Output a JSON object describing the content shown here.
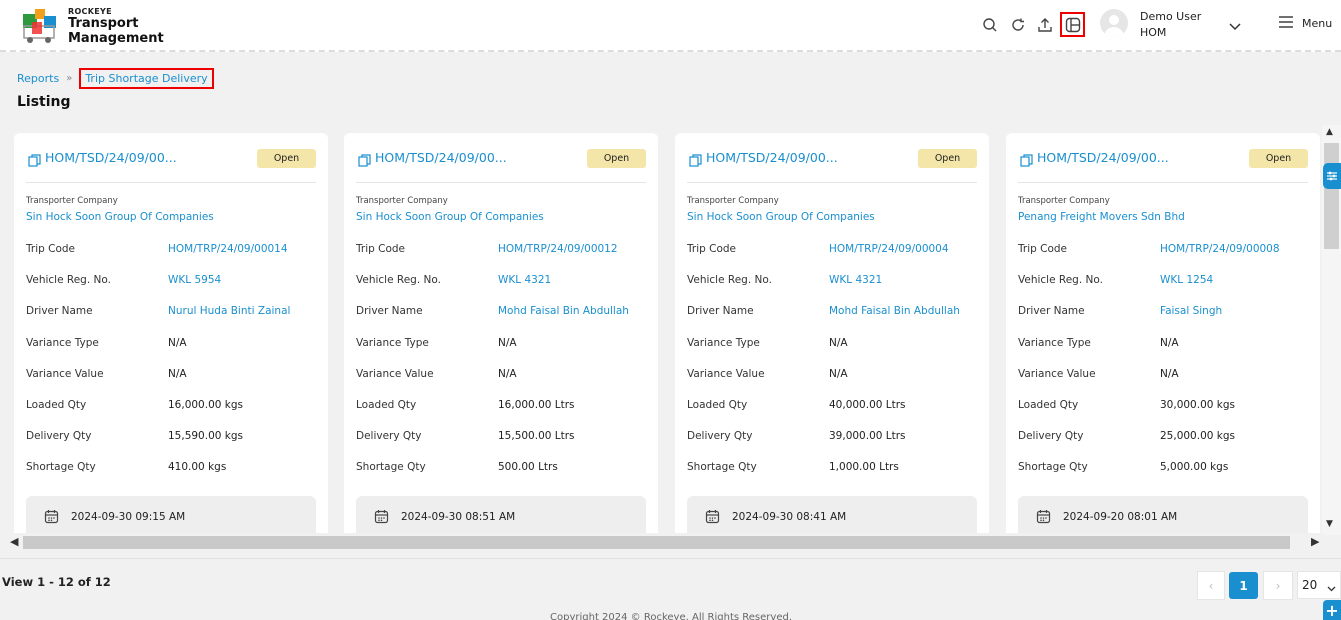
{
  "header": {
    "brand_small": "ROCKEYE",
    "brand_line1": "Transport",
    "brand_line2": "Management",
    "user": {
      "name": "Demo User",
      "branch": "HOM"
    },
    "menu_label": "Menu",
    "icons": [
      "search-icon",
      "refresh-icon",
      "upload-icon",
      "layout-icon",
      "avatar",
      "chevron-down-icon",
      "hamburger-icon"
    ]
  },
  "breadcrumb": {
    "parent": "Reports",
    "current": "Trip Shortage Delivery"
  },
  "page_title": "Listing",
  "labels": {
    "company": "Transporter Company",
    "trip_code": "Trip Code",
    "vehicle": "Vehicle Reg. No.",
    "driver": "Driver Name",
    "variance_type": "Variance Type",
    "variance_value": "Variance Value",
    "loaded": "Loaded Qty",
    "delivery": "Delivery Qty",
    "shortage": "Shortage Qty"
  },
  "cards": [
    {
      "code": "HOM/TSD/24/09/00...",
      "status": "Open",
      "company": "Sin Hock Soon Group Of Companies",
      "trip_code": "HOM/TRP/24/09/00014",
      "vehicle": "WKL 5954",
      "driver": "Nurul Huda Binti Zainal",
      "variance_type": "N/A",
      "variance_value": "N/A",
      "loaded": "16,000.00 kgs",
      "delivery": "15,590.00 kgs",
      "shortage": "410.00 kgs",
      "date": "2024-09-30 09:15 AM"
    },
    {
      "code": "HOM/TSD/24/09/00...",
      "status": "Open",
      "company": "Sin Hock Soon Group Of Companies",
      "trip_code": "HOM/TRP/24/09/00012",
      "vehicle": "WKL 4321",
      "driver": "Mohd Faisal Bin Abdullah",
      "variance_type": "N/A",
      "variance_value": "N/A",
      "loaded": "16,000.00 Ltrs",
      "delivery": "15,500.00 Ltrs",
      "shortage": "500.00 Ltrs",
      "date": "2024-09-30 08:51 AM"
    },
    {
      "code": "HOM/TSD/24/09/00...",
      "status": "Open",
      "company": "Sin Hock Soon Group Of Companies",
      "trip_code": "HOM/TRP/24/09/00004",
      "vehicle": "WKL 4321",
      "driver": "Mohd Faisal Bin Abdullah",
      "variance_type": "N/A",
      "variance_value": "N/A",
      "loaded": "40,000.00 Ltrs",
      "delivery": "39,000.00 Ltrs",
      "shortage": "1,000.00 Ltrs",
      "date": "2024-09-30 08:41 AM"
    },
    {
      "code": "HOM/TSD/24/09/00...",
      "status": "Open",
      "company": "Penang Freight Movers Sdn Bhd",
      "trip_code": "HOM/TRP/24/09/00008",
      "vehicle": "WKL 1254",
      "driver": "Faisal Singh",
      "variance_type": "N/A",
      "variance_value": "N/A",
      "loaded": "30,000.00 kgs",
      "delivery": "25,000.00 kgs",
      "shortage": "5,000.00 kgs",
      "date": "2024-09-20 08:01 AM"
    }
  ],
  "footer": {
    "view_count": "View 1 - 12 of 12",
    "current_page": "1",
    "page_size": "20",
    "prev_icon": "chevron-left-icon",
    "next_icon": "chevron-right-icon",
    "copyright": "Copyright 2024 © Rockeye. All Rights Reserved."
  },
  "colors": {
    "accent": "#1a8fcf",
    "badge_open": "#f3e6a8",
    "highlight": "#e00000"
  }
}
